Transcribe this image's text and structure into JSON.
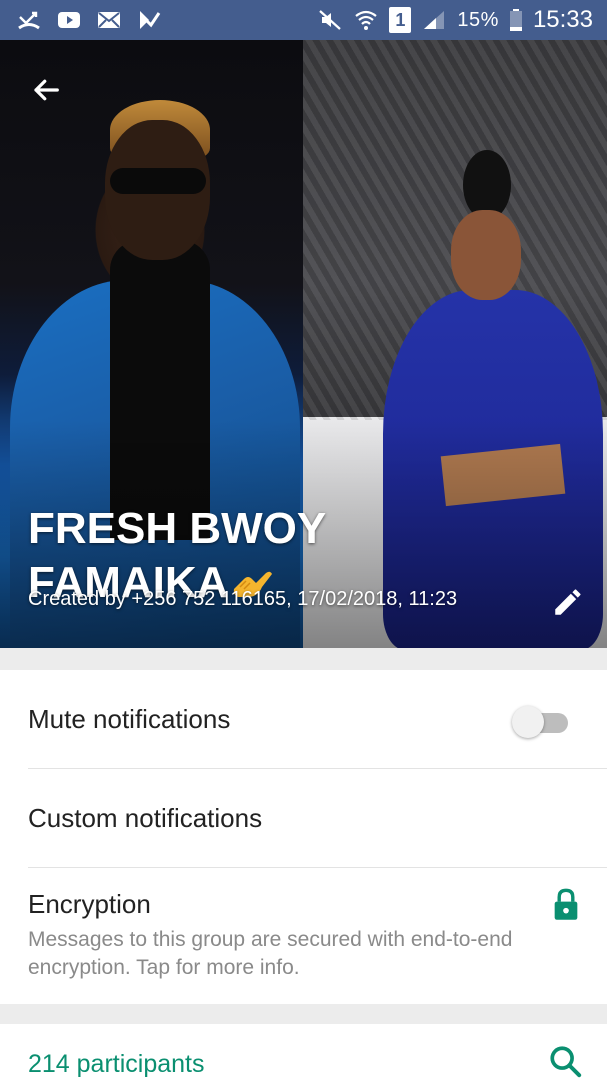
{
  "status_bar": {
    "battery": "15%",
    "time": "15:33",
    "sim": "1",
    "background": "#445d8e",
    "left_icons": [
      "missed-call-icon",
      "youtube-icon",
      "mail-icon",
      "checklist-icon"
    ],
    "right_icons": [
      "mute-icon",
      "wifi-icon",
      "sim-icon",
      "signal-icon",
      "battery-icon"
    ]
  },
  "header": {
    "group_name": "FRESH BWOY FAMAIKA",
    "emoji": "call-me-hand-icon",
    "created_by": "Created by +256 752 116165, 17/02/2018, 11:23"
  },
  "settings": {
    "mute": {
      "label": "Mute notifications",
      "enabled": false
    },
    "custom": {
      "label": "Custom notifications"
    },
    "encryption": {
      "label": "Encryption",
      "description": "Messages to this group are secured with end-to-end encryption. Tap for more info."
    }
  },
  "participants": {
    "label": "214 participants"
  },
  "colors": {
    "accent": "#0a8f70",
    "divider": "#e3e3e3",
    "section_gap": "#ececec"
  }
}
